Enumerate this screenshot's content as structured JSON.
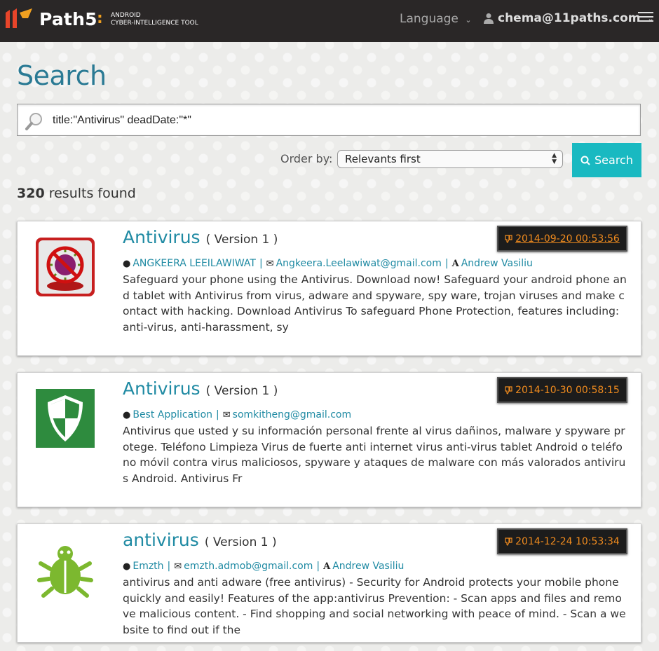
{
  "header": {
    "brand": "Path5",
    "tagline_line1": "ANDROID",
    "tagline_line2": "CYBER-INTELLIGENCE TOOL",
    "language_label": "Language",
    "user_email": "chema@11paths.com"
  },
  "page": {
    "title": "Search",
    "query": "title:\"Antivirus\" deadDate:\"*\"",
    "order_label": "Order by:",
    "order_selected": "Relevants first",
    "search_button": "Search",
    "results_count": "320",
    "results_suffix": " results found"
  },
  "colors": {
    "accent": "#19b9c1",
    "link": "#1f8aa3",
    "date_text": "#f08b1e",
    "topbar": "#2a2727"
  },
  "results": [
    {
      "icon": "virus-blocked-icon",
      "name": "Antivirus",
      "version": "( Version 1 )",
      "date": "2014-09-20 00:53:56",
      "developer": "ANGKEERA LEEILAWIWAT",
      "email": "Angkeera.Leelawiwat@gmail.com",
      "signer": "Andrew Vasiliu",
      "description": "Safeguard your phone using the Antivirus. Download now! Safeguard your android phone and tablet with Antivirus from virus, adware and spyware, spy ware, trojan viruses and make contact with hacking. Download Antivirus To safeguard Phone Protection, features including: anti-virus, anti-harassment, sy"
    },
    {
      "icon": "shield-icon",
      "name": "Antivirus",
      "version": "( Version 1 )",
      "date": "2014-10-30 00:58:15",
      "developer": "Best Application",
      "email": "somkitheng@gmail.com",
      "signer": "",
      "description": "Antivirus que usted y su información personal frente al virus dañinos, malware y spyware protege.  Teléfono Limpieza Virus de fuerte anti internet virus anti-virus tablet Android o teléfono móvil contra virus maliciosos, spyware y ataques de malware con más valorados antivirus Android. Antivirus Fr"
    },
    {
      "icon": "bug-icon",
      "name": "antivirus",
      "version": "( Version 1 )",
      "date": "2014-12-24 10:53:34",
      "developer": "Emzth",
      "email": "emzth.admob@gmail.com",
      "signer": "Andrew Vasiliu",
      "description": "antivirus and anti adware (free antivirus) - Security for Android protects your mobile phone quickly and easily! Features of the app:antivirus Prevention: - Scan apps and files and remove malicious content. - Find shopping and social networking with peace of mind. - Scan a website to find out if the"
    }
  ]
}
